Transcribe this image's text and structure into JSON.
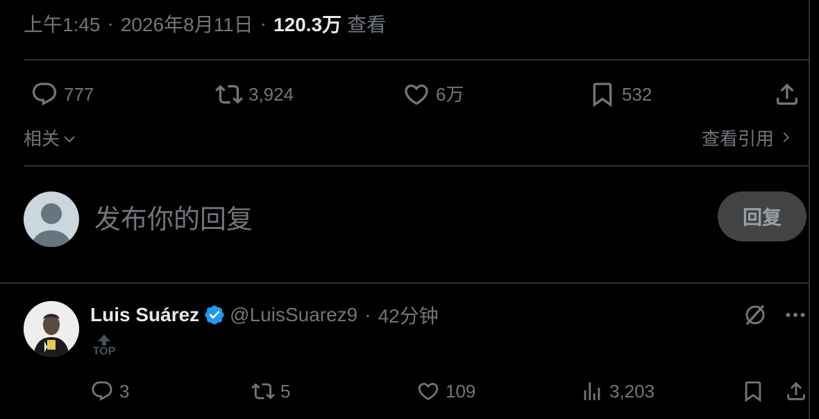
{
  "tweet": {
    "time": "上午1:45",
    "sep1": "·",
    "date": "2026年8月11日",
    "sep2": "·",
    "views_count": "120.3万",
    "views_label": "查看"
  },
  "actions": {
    "replies": "777",
    "retweets": "3,924",
    "likes": "6万",
    "bookmarks": "532"
  },
  "related": {
    "label": "相关"
  },
  "quotes": {
    "label": "查看引用"
  },
  "reply_box": {
    "placeholder": "发布你的回复",
    "button": "回复"
  },
  "post": {
    "name": "Luis Suárez",
    "handle": "@LuisSuarez9",
    "sep": "·",
    "time": "42分钟",
    "top_label": "TOP",
    "replies": "3",
    "retweets": "5",
    "likes": "109",
    "views": "3,203"
  },
  "colors": {
    "background": "#000000",
    "text": "#e7e9ea",
    "muted": "#71767b",
    "divider": "#2f3336",
    "verified": "#1d9bf0"
  },
  "icons": [
    "reply-icon",
    "retweet-icon",
    "like-icon",
    "bookmark-icon",
    "share-icon",
    "chevron-down-icon",
    "chevron-right-icon",
    "verified-icon",
    "grok-icon",
    "more-icon",
    "views-icon",
    "top-arrow-icon"
  ]
}
